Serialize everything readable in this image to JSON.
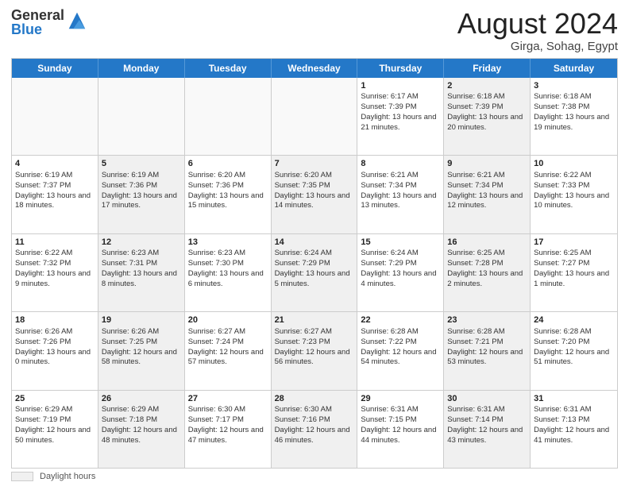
{
  "header": {
    "logo_general": "General",
    "logo_blue": "Blue",
    "month_title": "August 2024",
    "location": "Girga, Sohag, Egypt"
  },
  "calendar": {
    "days_of_week": [
      "Sunday",
      "Monday",
      "Tuesday",
      "Wednesday",
      "Thursday",
      "Friday",
      "Saturday"
    ],
    "rows": [
      [
        {
          "day": "",
          "info": "",
          "empty": true
        },
        {
          "day": "",
          "info": "",
          "empty": true
        },
        {
          "day": "",
          "info": "",
          "empty": true
        },
        {
          "day": "",
          "info": "",
          "empty": true
        },
        {
          "day": "1",
          "info": "Sunrise: 6:17 AM\nSunset: 7:39 PM\nDaylight: 13 hours and 21 minutes.",
          "shaded": false
        },
        {
          "day": "2",
          "info": "Sunrise: 6:18 AM\nSunset: 7:39 PM\nDaylight: 13 hours and 20 minutes.",
          "shaded": true
        },
        {
          "day": "3",
          "info": "Sunrise: 6:18 AM\nSunset: 7:38 PM\nDaylight: 13 hours and 19 minutes.",
          "shaded": false
        }
      ],
      [
        {
          "day": "4",
          "info": "Sunrise: 6:19 AM\nSunset: 7:37 PM\nDaylight: 13 hours and 18 minutes.",
          "shaded": false
        },
        {
          "day": "5",
          "info": "Sunrise: 6:19 AM\nSunset: 7:36 PM\nDaylight: 13 hours and 17 minutes.",
          "shaded": true
        },
        {
          "day": "6",
          "info": "Sunrise: 6:20 AM\nSunset: 7:36 PM\nDaylight: 13 hours and 15 minutes.",
          "shaded": false
        },
        {
          "day": "7",
          "info": "Sunrise: 6:20 AM\nSunset: 7:35 PM\nDaylight: 13 hours and 14 minutes.",
          "shaded": true
        },
        {
          "day": "8",
          "info": "Sunrise: 6:21 AM\nSunset: 7:34 PM\nDaylight: 13 hours and 13 minutes.",
          "shaded": false
        },
        {
          "day": "9",
          "info": "Sunrise: 6:21 AM\nSunset: 7:34 PM\nDaylight: 13 hours and 12 minutes.",
          "shaded": true
        },
        {
          "day": "10",
          "info": "Sunrise: 6:22 AM\nSunset: 7:33 PM\nDaylight: 13 hours and 10 minutes.",
          "shaded": false
        }
      ],
      [
        {
          "day": "11",
          "info": "Sunrise: 6:22 AM\nSunset: 7:32 PM\nDaylight: 13 hours and 9 minutes.",
          "shaded": false
        },
        {
          "day": "12",
          "info": "Sunrise: 6:23 AM\nSunset: 7:31 PM\nDaylight: 13 hours and 8 minutes.",
          "shaded": true
        },
        {
          "day": "13",
          "info": "Sunrise: 6:23 AM\nSunset: 7:30 PM\nDaylight: 13 hours and 6 minutes.",
          "shaded": false
        },
        {
          "day": "14",
          "info": "Sunrise: 6:24 AM\nSunset: 7:29 PM\nDaylight: 13 hours and 5 minutes.",
          "shaded": true
        },
        {
          "day": "15",
          "info": "Sunrise: 6:24 AM\nSunset: 7:29 PM\nDaylight: 13 hours and 4 minutes.",
          "shaded": false
        },
        {
          "day": "16",
          "info": "Sunrise: 6:25 AM\nSunset: 7:28 PM\nDaylight: 13 hours and 2 minutes.",
          "shaded": true
        },
        {
          "day": "17",
          "info": "Sunrise: 6:25 AM\nSunset: 7:27 PM\nDaylight: 13 hours and 1 minute.",
          "shaded": false
        }
      ],
      [
        {
          "day": "18",
          "info": "Sunrise: 6:26 AM\nSunset: 7:26 PM\nDaylight: 13 hours and 0 minutes.",
          "shaded": false
        },
        {
          "day": "19",
          "info": "Sunrise: 6:26 AM\nSunset: 7:25 PM\nDaylight: 12 hours and 58 minutes.",
          "shaded": true
        },
        {
          "day": "20",
          "info": "Sunrise: 6:27 AM\nSunset: 7:24 PM\nDaylight: 12 hours and 57 minutes.",
          "shaded": false
        },
        {
          "day": "21",
          "info": "Sunrise: 6:27 AM\nSunset: 7:23 PM\nDaylight: 12 hours and 56 minutes.",
          "shaded": true
        },
        {
          "day": "22",
          "info": "Sunrise: 6:28 AM\nSunset: 7:22 PM\nDaylight: 12 hours and 54 minutes.",
          "shaded": false
        },
        {
          "day": "23",
          "info": "Sunrise: 6:28 AM\nSunset: 7:21 PM\nDaylight: 12 hours and 53 minutes.",
          "shaded": true
        },
        {
          "day": "24",
          "info": "Sunrise: 6:28 AM\nSunset: 7:20 PM\nDaylight: 12 hours and 51 minutes.",
          "shaded": false
        }
      ],
      [
        {
          "day": "25",
          "info": "Sunrise: 6:29 AM\nSunset: 7:19 PM\nDaylight: 12 hours and 50 minutes.",
          "shaded": false
        },
        {
          "day": "26",
          "info": "Sunrise: 6:29 AM\nSunset: 7:18 PM\nDaylight: 12 hours and 48 minutes.",
          "shaded": true
        },
        {
          "day": "27",
          "info": "Sunrise: 6:30 AM\nSunset: 7:17 PM\nDaylight: 12 hours and 47 minutes.",
          "shaded": false
        },
        {
          "day": "28",
          "info": "Sunrise: 6:30 AM\nSunset: 7:16 PM\nDaylight: 12 hours and 46 minutes.",
          "shaded": true
        },
        {
          "day": "29",
          "info": "Sunrise: 6:31 AM\nSunset: 7:15 PM\nDaylight: 12 hours and 44 minutes.",
          "shaded": false
        },
        {
          "day": "30",
          "info": "Sunrise: 6:31 AM\nSunset: 7:14 PM\nDaylight: 12 hours and 43 minutes.",
          "shaded": true
        },
        {
          "day": "31",
          "info": "Sunrise: 6:31 AM\nSunset: 7:13 PM\nDaylight: 12 hours and 41 minutes.",
          "shaded": false
        }
      ]
    ]
  },
  "footer": {
    "swatch_label": "Daylight hours"
  }
}
